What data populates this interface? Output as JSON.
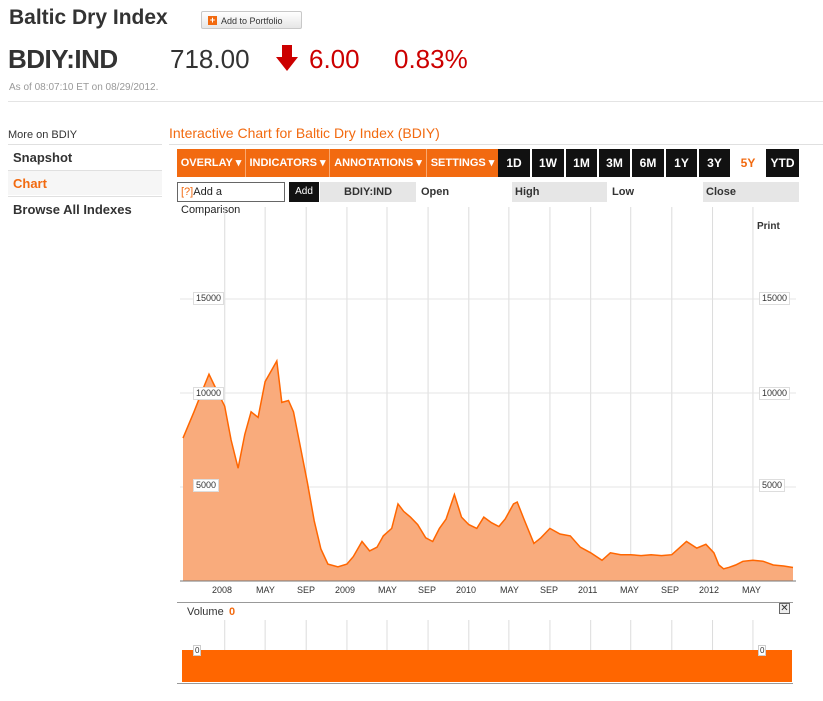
{
  "header": {
    "title": "Baltic Dry Index",
    "add_portfolio": "Add to Portfolio",
    "ticker": "BDIY:IND",
    "price": "718.00",
    "change": "6.00",
    "change_pct": "0.83%",
    "as_of": "As of 08:07:10 ET on 08/29/2012."
  },
  "sidebar": {
    "heading": "More on BDIY",
    "items": [
      {
        "label": "Snapshot"
      },
      {
        "label": "Chart"
      },
      {
        "label": "Browse All Indexes"
      }
    ],
    "active_index": 1
  },
  "chart_panel": {
    "title": "Interactive Chart for Baltic Dry Index (BDIY)",
    "tabs": [
      "OVERLAY ▾",
      "INDICATORS ▾",
      "ANNOTATIONS ▾",
      "SETTINGS ▾"
    ],
    "ranges": [
      "1D",
      "1W",
      "1M",
      "3M",
      "6M",
      "1Y",
      "3Y",
      "5Y",
      "YTD"
    ],
    "active_range": "5Y",
    "comparison_placeholder": "Add a Comparison",
    "comparison_help": "[?]",
    "add_button": "Add",
    "symbol": "BDIY:IND",
    "fields": [
      "Open",
      "High",
      "Low",
      "Close"
    ],
    "print": "Print",
    "volume_label": "Volume",
    "volume_value": "0",
    "volume_axis": "0",
    "close_glyph": "✕"
  },
  "colors": {
    "accent": "#f26a10",
    "down": "#cc0000",
    "area_fill": "#f9ab7c",
    "line": "#ff6600"
  },
  "chart_data": {
    "type": "area",
    "title": "",
    "y_ticks": [
      "15000",
      "10000",
      "5000"
    ],
    "ylim": [
      0,
      20000
    ],
    "x_ticks": [
      "2008",
      "MAY",
      "SEP",
      "2009",
      "MAY",
      "SEP",
      "2010",
      "MAY",
      "SEP",
      "2011",
      "MAY",
      "SEP",
      "2012",
      "MAY"
    ],
    "x_range": [
      "2007-08-29",
      "2012-08-29"
    ],
    "series": [
      {
        "x": [
          "2007-08-29",
          "2007-10-01",
          "2007-11-01",
          "2007-11-15",
          "2007-12-01",
          "2008-01-01",
          "2008-01-20",
          "2008-02-10",
          "2008-03-01",
          "2008-03-20",
          "2008-04-10",
          "2008-05-01",
          "2008-05-20",
          "2008-06-05",
          "2008-06-20",
          "2008-07-10",
          "2008-07-25",
          "2008-08-15",
          "2008-09-05",
          "2008-09-25",
          "2008-10-15",
          "2008-11-05",
          "2008-12-05",
          "2009-01-01",
          "2009-01-20",
          "2009-02-15",
          "2009-03-10",
          "2009-04-01",
          "2009-04-20",
          "2009-05-15",
          "2009-06-03",
          "2009-06-20",
          "2009-07-10",
          "2009-08-01",
          "2009-08-25",
          "2009-09-15",
          "2009-10-05",
          "2009-10-25",
          "2009-11-19",
          "2009-12-10",
          "2010-01-01",
          "2010-01-25",
          "2010-02-15",
          "2010-03-10",
          "2010-04-01",
          "2010-04-20",
          "2010-05-15",
          "2010-05-26",
          "2010-06-15",
          "2010-07-15",
          "2010-08-05",
          "2010-09-01",
          "2010-10-01",
          "2010-11-01",
          "2010-12-01",
          "2011-01-01",
          "2011-02-04",
          "2011-03-01",
          "2011-04-01",
          "2011-05-01",
          "2011-06-01",
          "2011-07-01",
          "2011-08-01",
          "2011-09-01",
          "2011-10-15",
          "2011-11-15",
          "2011-12-12",
          "2012-01-05",
          "2012-01-20",
          "2012-02-03",
          "2012-02-20",
          "2012-03-10",
          "2012-04-01",
          "2012-05-01",
          "2012-06-01",
          "2012-07-01",
          "2012-08-01",
          "2012-08-29"
        ],
        "y": [
          7600,
          9000,
          10400,
          11000,
          10400,
          9300,
          7500,
          6000,
          7800,
          9000,
          8700,
          10600,
          11200,
          11700,
          9500,
          9600,
          9000,
          7100,
          5200,
          3200,
          1700,
          900,
          750,
          900,
          1300,
          2100,
          1600,
          1800,
          2400,
          2800,
          4100,
          3700,
          3400,
          3000,
          2300,
          2100,
          2800,
          3300,
          4600,
          3400,
          3000,
          2800,
          3400,
          3100,
          2900,
          3300,
          4100,
          4200,
          3300,
          2000,
          2300,
          2800,
          2500,
          2400,
          1800,
          1500,
          1100,
          1500,
          1400,
          1400,
          1350,
          1400,
          1350,
          1400,
          2100,
          1750,
          1950,
          1500,
          850,
          650,
          730,
          850,
          1050,
          1100,
          1050,
          850,
          800,
          718
        ]
      }
    ]
  }
}
